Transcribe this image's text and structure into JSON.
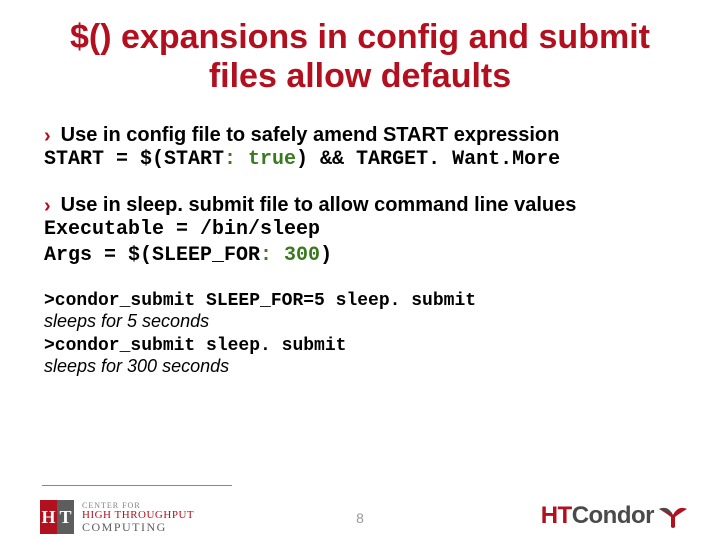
{
  "title": "$() expansions in config and submit files allow defaults",
  "b1": {
    "text": "Use in config file to safely amend START expression",
    "code_pre": "START = $(START",
    "code_hl": ": true",
    "code_post": ") && TARGET. Want.More"
  },
  "b2": {
    "text": "Use in sleep. submit file to allow command line values",
    "line1": "Executable = /bin/sleep",
    "line2_pre": "Args = $(SLEEP_FOR",
    "line2_hl": ": 300",
    "line2_post": ")"
  },
  "b3": {
    "cmd1": ">condor_submit SLEEP_FOR=5 sleep. submit",
    "note1": "sleeps for 5 seconds",
    "cmd2": ">condor_submit sleep. submit",
    "note2": "sleeps for 300 seconds"
  },
  "footer": {
    "page": "8",
    "left_center": "CENTER FOR",
    "left_ht": "HIGH THROUGHPUT",
    "left_comp": "COMPUTING",
    "right_ht": "HT",
    "right_condor": "Condor"
  }
}
